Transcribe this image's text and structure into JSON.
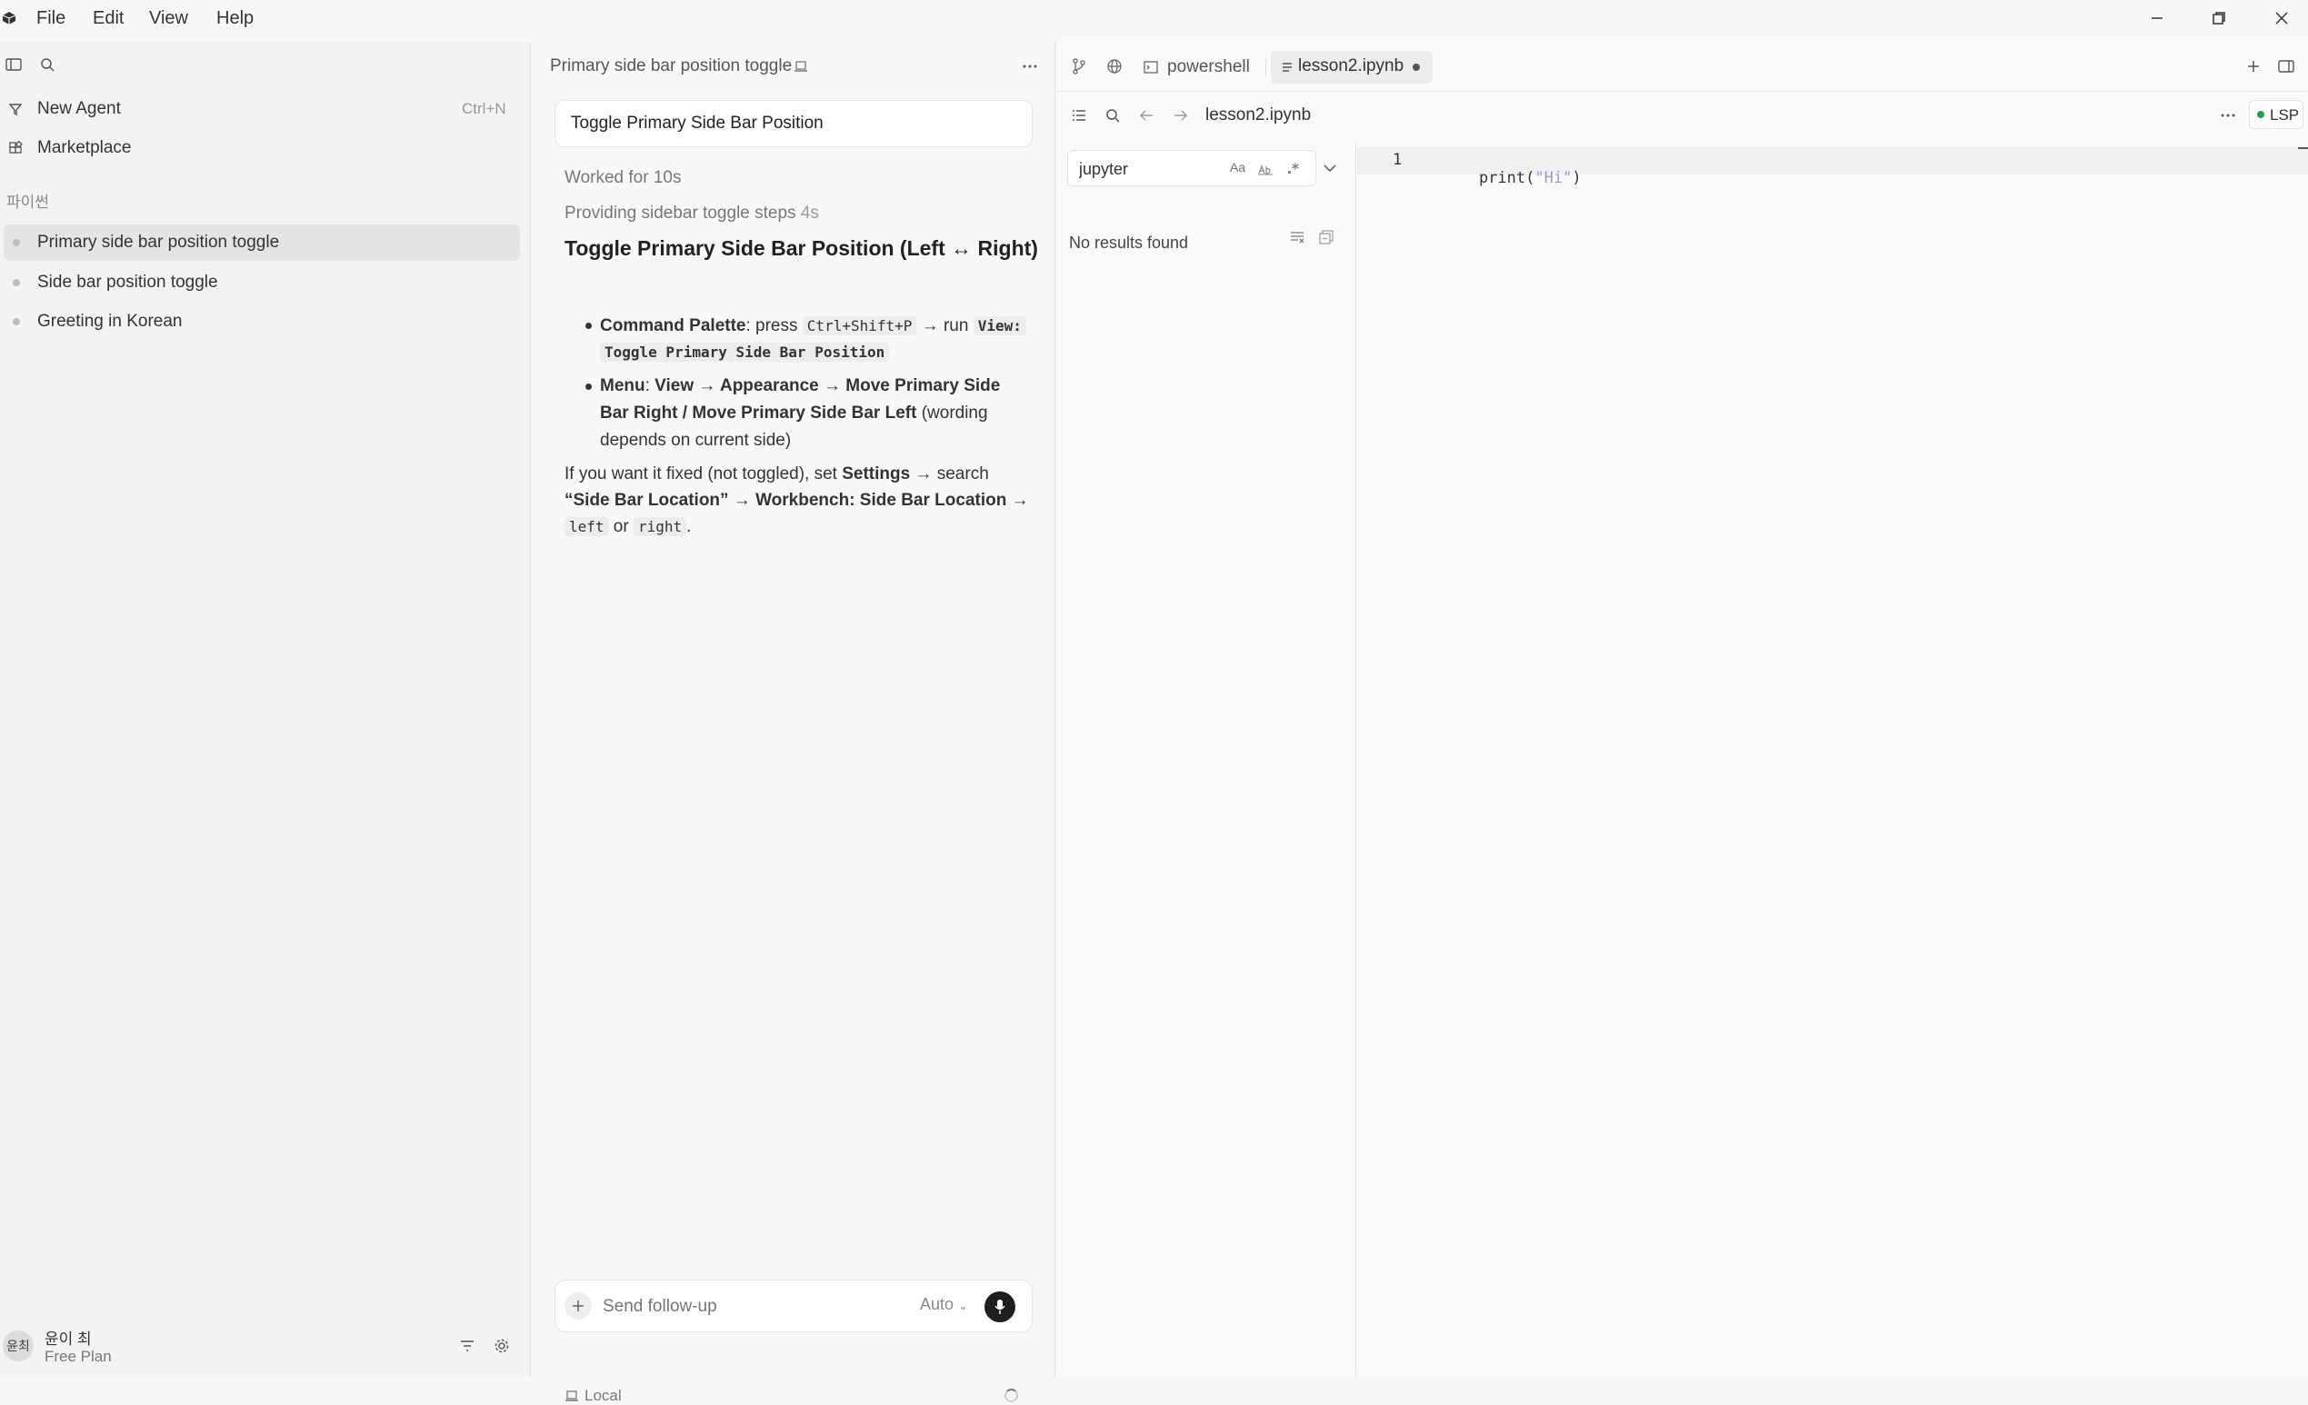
{
  "menubar": {
    "items": [
      "File",
      "Edit",
      "View",
      "Help"
    ]
  },
  "sidebar": {
    "new_agent_label": "New Agent",
    "new_agent_shortcut": "Ctrl+N",
    "marketplace_label": "Marketplace",
    "section_title": "파이썬",
    "items": [
      {
        "label": "Primary side bar position toggle"
      },
      {
        "label": "Side bar position toggle"
      },
      {
        "label": "Greeting in Korean"
      }
    ],
    "user": {
      "avatar_text": "윤최",
      "name": "윤이 최",
      "plan": "Free Plan"
    }
  },
  "chat": {
    "header_title": "Primary side bar position toggle",
    "user_message": "Toggle Primary Side Bar Position",
    "worked_for": "Worked for 10s",
    "step_label": "Providing sidebar toggle steps",
    "step_time": "4s",
    "heading": "Toggle Primary Side Bar Position (Left ↔ Right)",
    "bullet1": {
      "bold": "Command Palette",
      "text1": ": press ",
      "code1": "Ctrl+Shift+P",
      "text2": " → run ",
      "code2a": "View:",
      "code2b": "Toggle Primary Side Bar Position"
    },
    "bullet2": {
      "bold": "Menu",
      "text1": ": ",
      "path_line1": "View → Appearance → Move Primary Side",
      "path_line2": "Bar Right / Move Primary Side Bar Left",
      "tail_line1": " (wording",
      "tail_line2": "depends on current side)"
    },
    "para": {
      "text1": "If you want it fixed (not toggled), set ",
      "b1": "Settings",
      "text2": " → search",
      "b2": "“Side Bar Location”",
      "text3": " → ",
      "b3": "Workbench: Side Bar Location",
      "text4": " →",
      "code1": "left",
      "text5": " or ",
      "code2": "right",
      "text6": "."
    },
    "input_placeholder": "Send follow-up",
    "mode_label": "Auto",
    "footer_label": "Local"
  },
  "editor": {
    "tabs": [
      {
        "label": "powershell"
      },
      {
        "label": "lesson2.ipynb"
      }
    ],
    "breadcrumb": "lesson2.ipynb",
    "lsp_label": "LSP",
    "search": {
      "value": "jupyter",
      "result": "No results found",
      "case_label": "Aa"
    },
    "code": {
      "line_number": "1",
      "fn": "print(",
      "str": "\"Hi\"",
      "close": ")"
    }
  },
  "colors": {
    "accent": "#0a7aca",
    "lsp_dot": "#22a04b",
    "string": "#a0a0d0"
  }
}
